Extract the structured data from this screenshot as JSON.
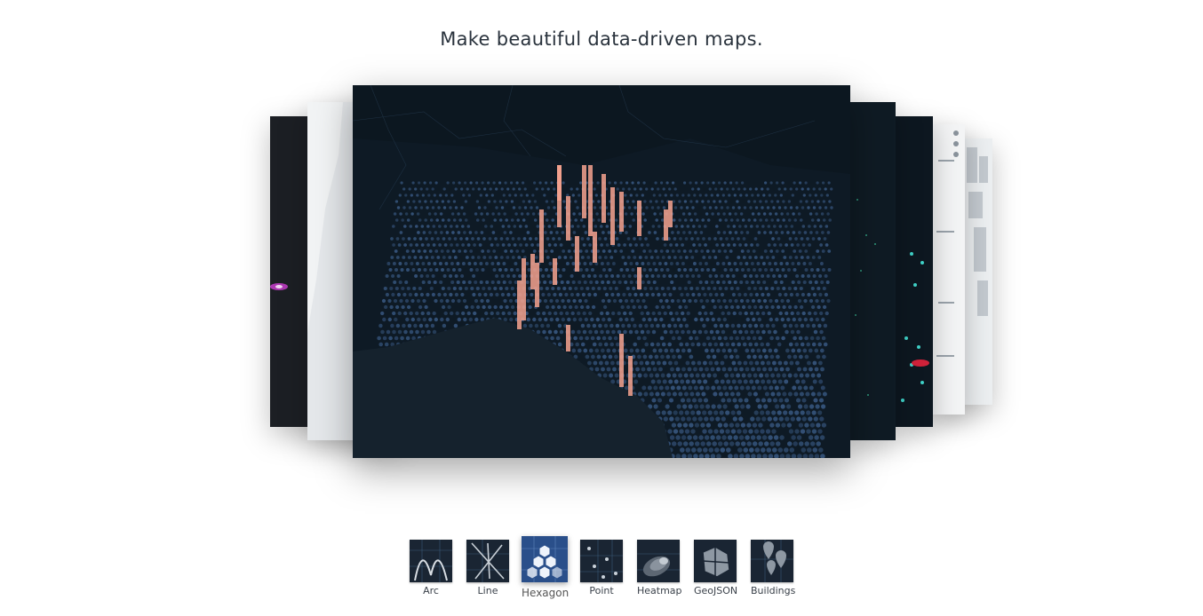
{
  "headline": "Make beautiful data-driven maps.",
  "colors": {
    "map_dark": "#0f1c27",
    "hex_blue": "#3d5f8c",
    "hex_peak": "#f6a38f",
    "accent_teal": "#3fd1c7",
    "thumb_bg": "#1a2533"
  },
  "layers": [
    {
      "label": "Arc",
      "icon": "arc-icon",
      "active": false
    },
    {
      "label": "Line",
      "icon": "line-icon",
      "active": false
    },
    {
      "label": "Hexagon",
      "icon": "hexagon-icon",
      "active": true
    },
    {
      "label": "Point",
      "icon": "point-icon",
      "active": false
    },
    {
      "label": "Heatmap",
      "icon": "heatmap-icon",
      "active": false
    },
    {
      "label": "GeoJSON",
      "icon": "geojson-icon",
      "active": false
    },
    {
      "label": "Buildings",
      "icon": "buildings-icon",
      "active": false
    }
  ],
  "carousel": {
    "active_slide": "Hexagon",
    "slides": [
      "Arc",
      "Line",
      "Hexagon",
      "Point",
      "Heatmap",
      "GeoJSON",
      "Buildings"
    ]
  }
}
